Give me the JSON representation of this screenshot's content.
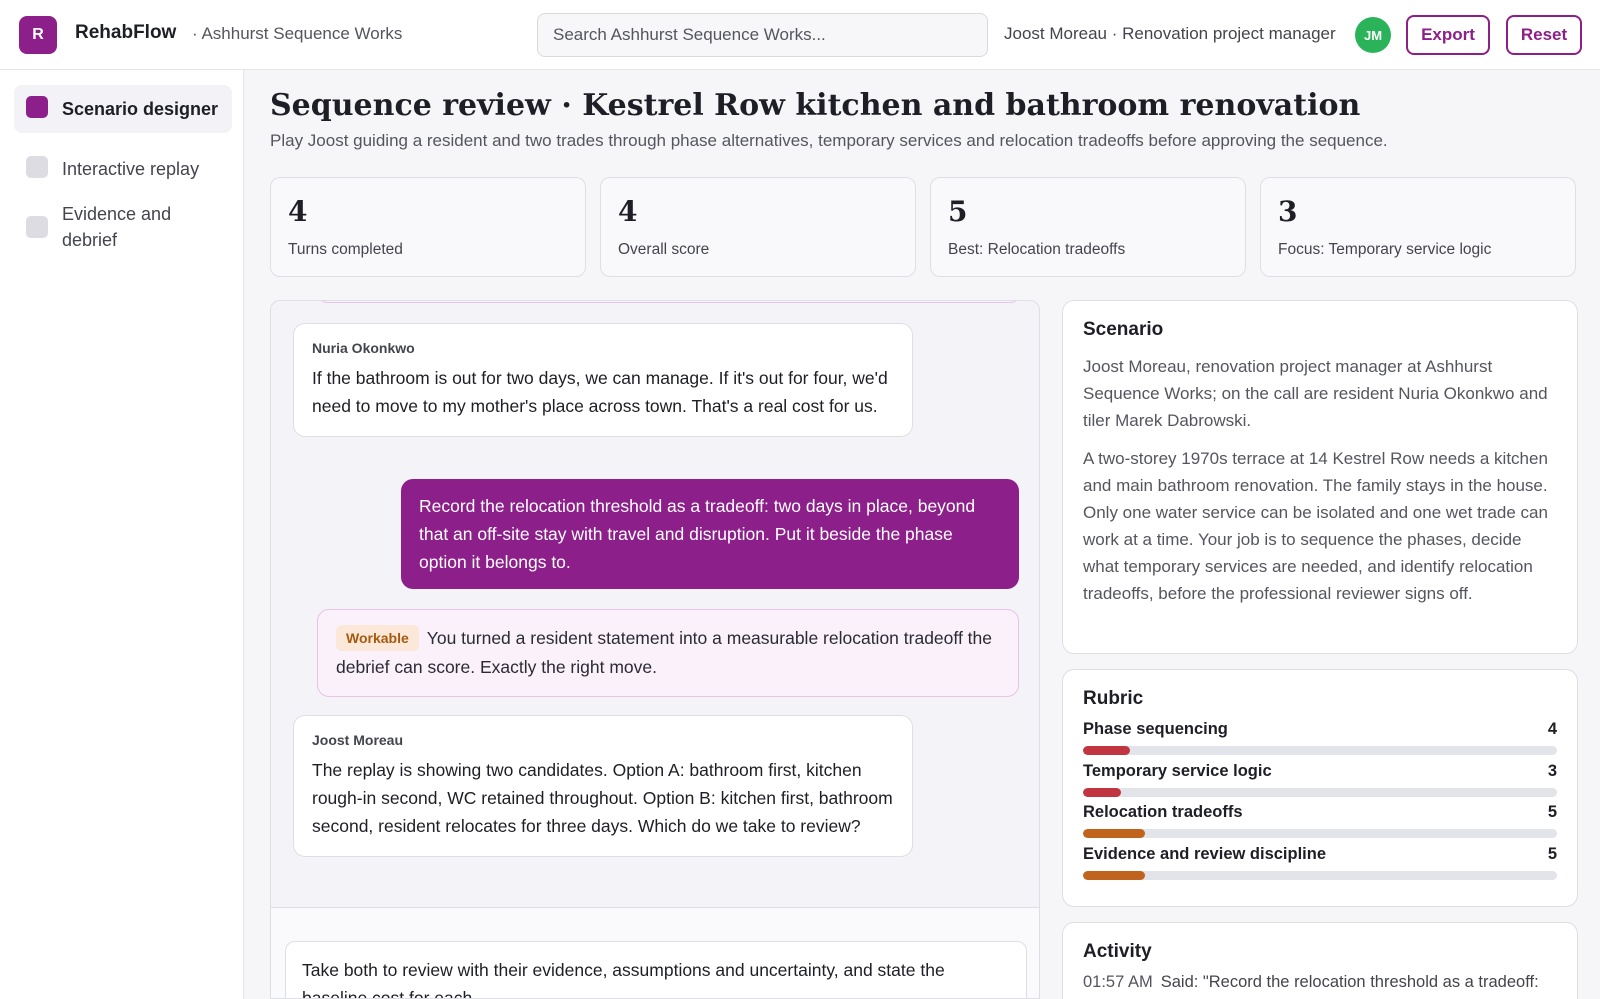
{
  "header": {
    "logo_letter": "R",
    "app_name": "RehabFlow",
    "org_name": "· Ashhurst Sequence Works",
    "search_placeholder": "Search Ashhurst Sequence Works...",
    "user_info": "Joost Moreau · Renovation project manager",
    "avatar_initials": "JM",
    "export_label": "Export",
    "reset_label": "Reset"
  },
  "sidebar": {
    "items": [
      {
        "label": "Scenario designer",
        "active": true
      },
      {
        "label": "Interactive replay",
        "active": false
      },
      {
        "label": "Evidence and debrief",
        "active": false
      }
    ]
  },
  "main": {
    "title": "Sequence review · Kestrel Row kitchen and bathroom renovation",
    "subtitle": "Play Joost guiding a resident and two trades through phase alternatives, temporary services and relocation tradeoffs before approving the sequence.",
    "stats": [
      {
        "value": "4",
        "label": "Turns completed"
      },
      {
        "value": "4",
        "label": "Overall score"
      },
      {
        "value": "5",
        "label": "Best: Relocation tradeoffs"
      },
      {
        "value": "3",
        "label": "Focus: Temporary service logic"
      }
    ]
  },
  "conversation": {
    "messages": [
      {
        "author": "Nuria Okonkwo",
        "text": "If the bathroom is out for two days, we can manage. If it's out for four, we'd need to move to my mother's place across town. That's a real cost for us."
      },
      {
        "text": "Record the relocation threshold as a tradeoff: two days in place, beyond that an off-site stay with travel and disruption. Put it beside the phase option it belongs to."
      },
      {
        "author": "Joost Moreau",
        "text": "The replay is showing two candidates. Option A: bathroom first, kitchen rough-in second, WC retained throughout. Option B: kitchen first, bathroom second, resident relocates for three days. Which do we take to review?"
      }
    ],
    "feedback": {
      "badge": "Workable",
      "text": "You turned a resident statement into a measurable relocation tradeoff the debrief can score. Exactly the right move."
    },
    "composer_text": "Take both to review with their evidence, assumptions and uncertainty, and state the baseline cost for each."
  },
  "scenario": {
    "title": "Scenario",
    "para1": "Joost Moreau, renovation project manager at Ashhurst Sequence Works; on the call are resident Nuria Okonkwo and tiler Marek Dabrowski.",
    "para2": "A two-storey 1970s terrace at 14 Kestrel Row needs a kitchen and main bathroom renovation. The family stays in the house. Only one water service can be isolated and one wet trade can work at a time. Your job is to sequence the phases, decide what temporary services are needed, and identify relocation tradeoffs, before the professional reviewer signs off."
  },
  "rubric": {
    "title": "Rubric",
    "items": [
      {
        "label": "Phase sequencing",
        "score": "4",
        "fill": 0.1,
        "color": "#c0353f"
      },
      {
        "label": "Temporary service logic",
        "score": "3",
        "fill": 0.08,
        "color": "#c0353f"
      },
      {
        "label": "Relocation tradeoffs",
        "score": "5",
        "fill": 0.13,
        "color": "#c0631c"
      },
      {
        "label": "Evidence and review discipline",
        "score": "5",
        "fill": 0.13,
        "color": "#c0631c"
      }
    ]
  },
  "activity": {
    "title": "Activity",
    "rows": [
      {
        "time": "01:57 AM",
        "text": "Said: \"Record the relocation threshold as a tradeoff:"
      }
    ]
  }
}
